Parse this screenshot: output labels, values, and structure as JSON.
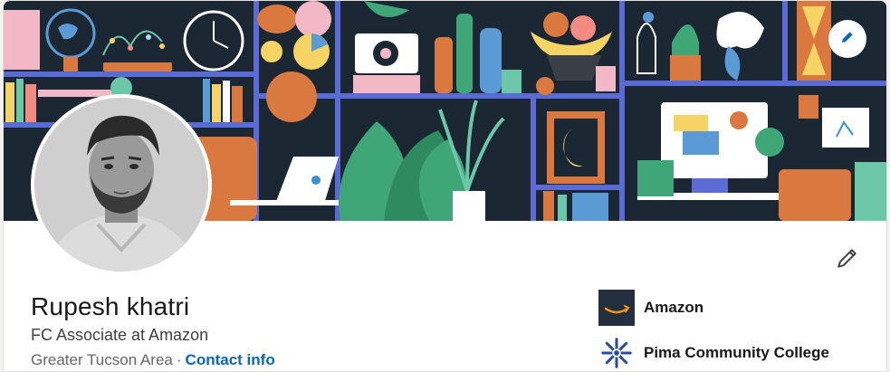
{
  "profile": {
    "name": "Rupesh khatri",
    "headline": "FC Associate at Amazon",
    "location": "Greater Tucson Area",
    "separator": "·",
    "contact_label": "Contact info"
  },
  "organizations": [
    {
      "label": "Amazon",
      "icon": "amazon-logo"
    },
    {
      "label": "Pima Community College",
      "icon": "pima-logo"
    }
  ],
  "icons": {
    "edit_cover": "pencil-icon",
    "edit_intro": "pencil-icon"
  },
  "colors": {
    "accent": "#0a66c2",
    "banner_bg": "#1b2733",
    "shelf": "#5b6bd6"
  }
}
